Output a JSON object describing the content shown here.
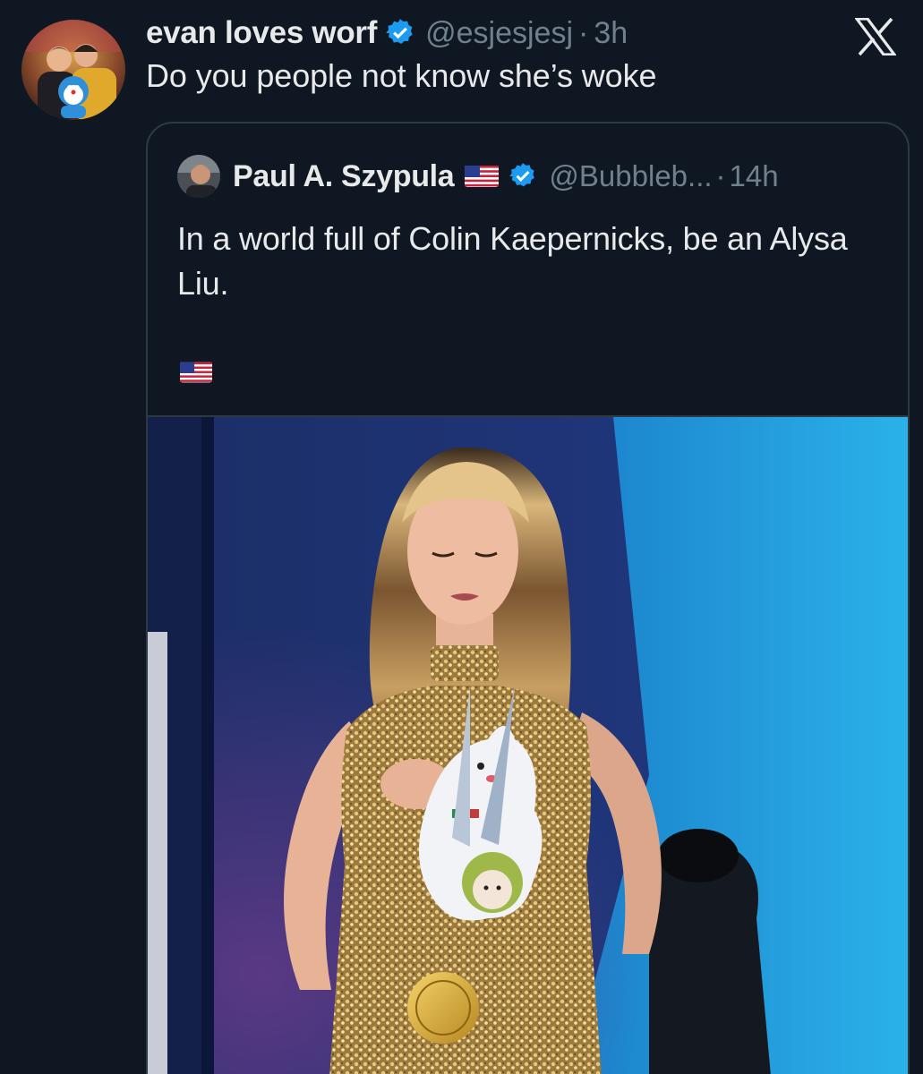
{
  "tweet": {
    "display_name": "evan loves worf",
    "handle": "@esjesjesj",
    "separator": "·",
    "time": "3h",
    "text": "Do you people not know she’s woke"
  },
  "quoted_tweet": {
    "display_name": "Paul A. Szypula",
    "handle": "@Bubbleb...",
    "separator": "·",
    "time": "14h",
    "text": "In a world full of Colin Kaepernicks, be an Alysa Liu."
  },
  "icons": {
    "verified": "verified-badge-icon",
    "flag": "us-flag-icon",
    "close": "x-logo-icon"
  },
  "colors": {
    "background": "#0f1822",
    "text_primary": "#e7e9ea",
    "text_secondary": "#71808d",
    "verified_blue": "#1d9bf0",
    "card_border": "#2f3943"
  }
}
